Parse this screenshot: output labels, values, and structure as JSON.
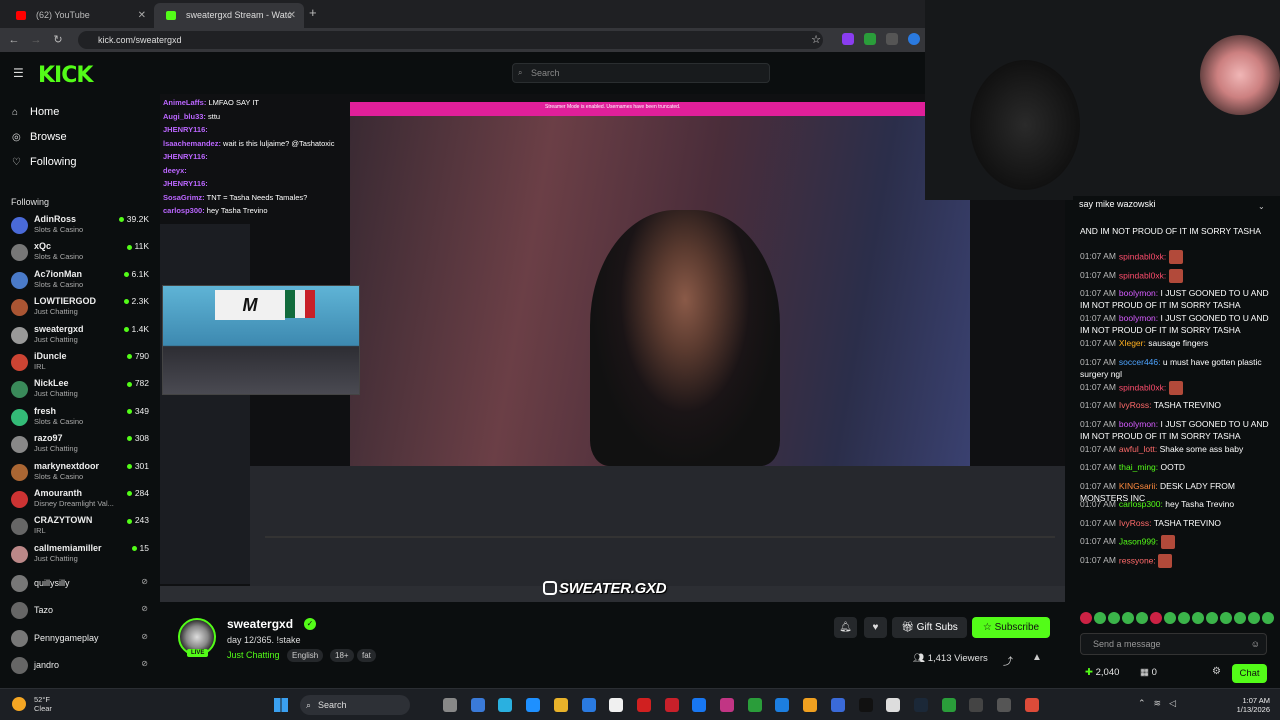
{
  "browser": {
    "tabs": [
      {
        "title": "(62) YouTube",
        "active": false,
        "favicon_color": "#ff0000"
      },
      {
        "title": "sweatergxd Stream - Watc",
        "active": true,
        "favicon_color": "#53fc18"
      }
    ],
    "url": "kick.com/sweatergxd"
  },
  "header": {
    "logo": "KICK",
    "search_placeholder": "Search"
  },
  "nav": [
    {
      "label": "Home",
      "icon": "home-icon"
    },
    {
      "label": "Browse",
      "icon": "compass-icon"
    },
    {
      "label": "Following",
      "icon": "heart-icon"
    }
  ],
  "following_header": "Following",
  "following": [
    {
      "name": "AdinRoss",
      "category": "Slots & Casino",
      "viewers": "39.2K",
      "color": "#4a6ad8"
    },
    {
      "name": "xQc",
      "category": "Slots & Casino",
      "viewers": "11K",
      "color": "#777"
    },
    {
      "name": "Ac7ionMan",
      "category": "Slots & Casino",
      "viewers": "6.1K",
      "color": "#4a7ac8"
    },
    {
      "name": "LOWTIERGOD",
      "category": "Just Chatting",
      "viewers": "2.3K",
      "color": "#aa5533"
    },
    {
      "name": "sweatergxd",
      "category": "Just Chatting",
      "viewers": "1.4K",
      "color": "#999"
    },
    {
      "name": "iDuncle",
      "category": "IRL",
      "viewers": "790",
      "color": "#c43"
    },
    {
      "name": "NickLee",
      "category": "Just Chatting",
      "viewers": "782",
      "color": "#3a8a5a"
    },
    {
      "name": "fresh",
      "category": "Slots & Casino",
      "viewers": "349",
      "color": "#3b7"
    },
    {
      "name": "razo97",
      "category": "Just Chatting",
      "viewers": "308",
      "color": "#888"
    },
    {
      "name": "markynextdoor",
      "category": "Slots & Casino",
      "viewers": "301",
      "color": "#a63"
    },
    {
      "name": "Amouranth",
      "category": "Disney Dreamlight Val...",
      "viewers": "284",
      "color": "#c33"
    },
    {
      "name": "CRAZYTOWN",
      "category": "IRL",
      "viewers": "243",
      "color": "#666"
    },
    {
      "name": "callmemiamiller",
      "category": "Just Chatting",
      "viewers": "15",
      "color": "#b88"
    }
  ],
  "following_offline": [
    {
      "name": "quillysilly",
      "color": "#777"
    },
    {
      "name": "Tazo",
      "color": "#666"
    },
    {
      "name": "Pennygameplay",
      "color": "#777"
    },
    {
      "name": "jandro",
      "color": "#666"
    }
  ],
  "video": {
    "top_banner": "Streamer Mode is enabled. Usernames have been truncated.",
    "watermark": "SWEATER.GXD",
    "overlay_chat": [
      {
        "user": "AnimeLaffs:",
        "text": "LMFAO SAY IT"
      },
      {
        "user": "Augi_blu33:",
        "text": "sttu"
      },
      {
        "user": "JHENRY116:",
        "text": ""
      },
      {
        "user": "lsaachemandez:",
        "text": "wait is this luljaime? @Tashatoxic"
      },
      {
        "user": "JHENRY116:",
        "text": ""
      },
      {
        "user": "deeyx:",
        "text": ""
      },
      {
        "user": "JHENRY116:",
        "text": ""
      },
      {
        "user": "SosaGrimz:",
        "text": "TNT = Tasha Needs Tamales?"
      },
      {
        "user": "carlosp300:",
        "text": "hey Tasha Trevino"
      }
    ],
    "webcam_text": "M"
  },
  "chat": {
    "pinned": "say mike wazowski",
    "messages": [
      {
        "time": "",
        "user": "",
        "color": "#fff",
        "text": "AND IM NOT PROUD OF IT IM SORRY TASHA"
      },
      {
        "time": "01:07 AM",
        "user": "spindabl0xk:",
        "color": "#ff4d6d",
        "text": "",
        "emote": true
      },
      {
        "time": "01:07 AM",
        "user": "spindabl0xk:",
        "color": "#ff4d6d",
        "text": "",
        "emote": true
      },
      {
        "time": "01:07 AM",
        "user": "boolymon:",
        "color": "#d65cff",
        "text": "I JUST GOONED TO U AND IM NOT PROUD OF IT IM SORRY TASHA"
      },
      {
        "time": "01:07 AM",
        "user": "boolymon:",
        "color": "#d65cff",
        "text": "I JUST GOONED TO U AND IM NOT PROUD OF IT IM SORRY TASHA"
      },
      {
        "time": "01:07 AM",
        "user": "Xleger:",
        "color": "#ffb020",
        "text": "sausage fingers"
      },
      {
        "time": "01:07 AM",
        "user": "soccer446:",
        "color": "#4da3ff",
        "text": "u must have gotten plastic surgery ngl"
      },
      {
        "time": "01:07 AM",
        "user": "spindabl0xk:",
        "color": "#ff4d6d",
        "text": "",
        "emote": true
      },
      {
        "time": "01:07 AM",
        "user": "IvyRoss:",
        "color": "#ff6a6a",
        "text": "TASHA TREVINO"
      },
      {
        "time": "01:07 AM",
        "user": "boolymon:",
        "color": "#d65cff",
        "text": "I JUST GOONED TO U AND IM NOT PROUD OF IT IM SORRY TASHA"
      },
      {
        "time": "01:07 AM",
        "user": "awful_lott:",
        "color": "#ff6a6a",
        "text": "Shake some ass baby"
      },
      {
        "time": "01:07 AM",
        "user": "thai_ming:",
        "color": "#53fc18",
        "text": "OOTD"
      },
      {
        "time": "01:07 AM",
        "user": "KINGsarii:",
        "color": "#ff8a3d",
        "text": "DESK LADY FROM MONSTERS INC"
      },
      {
        "time": "01:07 AM",
        "user": "carlosp300:",
        "color": "#53fc18",
        "text": "hey Tasha Trevino"
      },
      {
        "time": "01:07 AM",
        "user": "IvyRoss:",
        "color": "#ff6a6a",
        "text": "TASHA TREVINO"
      },
      {
        "time": "01:07 AM",
        "user": "Jason999:",
        "color": "#53fc18",
        "text": "",
        "emote": true
      },
      {
        "time": "01:07 AM",
        "user": "ressyone:",
        "color": "#ff6a6a",
        "text": "",
        "emote": true
      }
    ],
    "send_placeholder": "Send a message",
    "points": "2,040",
    "zero_count": "0",
    "chat_button": "Chat"
  },
  "stream": {
    "name": "sweatergxd",
    "title": "day 12/365. !stake",
    "category": "Just Chatting",
    "tags": [
      "English",
      "18+",
      "fat"
    ],
    "live_badge": "LIVE",
    "viewers": "1,413 Viewers",
    "gift_label": "Gift Subs",
    "subscribe_label": "Subscribe"
  },
  "taskbar": {
    "weather_temp": "52°F",
    "weather_desc": "Clear",
    "search_label": "Search",
    "time": "1:07 AM",
    "date": "1/13/2026"
  },
  "colors": {
    "accent": "#53fc18",
    "background": "#0b0e0f"
  }
}
